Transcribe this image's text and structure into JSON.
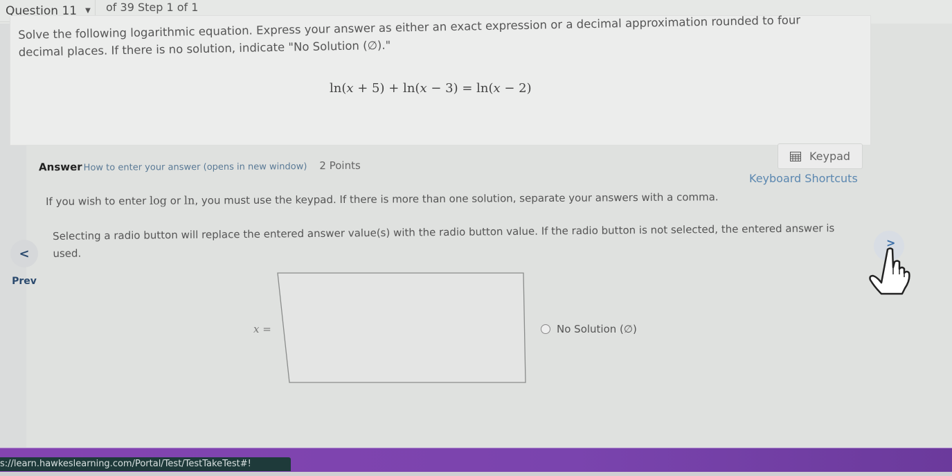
{
  "header": {
    "question_selector": "Question 11",
    "question_progress": "of 39 Step 1 of 1"
  },
  "question": {
    "instruction": "Solve the following logarithmic equation. Express your answer as either an exact expression or a decimal approximation rounded to four decimal places. If there is no solution, indicate \"No Solution (∅).\"",
    "equation": {
      "part1": "ln(",
      "var1": "x",
      "part2": " + 5) + ln(",
      "var2": "x",
      "part3": " − 3)  =  ln(",
      "var3": "x",
      "part4": " − 2)"
    }
  },
  "answer": {
    "label": "Answer",
    "how_to_link": "How to enter your answer (opens in new window)",
    "points": "2 Points",
    "keypad_label": "Keypad",
    "keyboard_shortcuts": "Keyboard Shortcuts",
    "instruction_keypad_pre": "If you wish to enter ",
    "instruction_keypad_log": "log",
    "instruction_keypad_or": " or ",
    "instruction_keypad_ln": "ln",
    "instruction_keypad_post": ", you must use the keypad. If there is more than one solution, separate your answers with a comma.",
    "instruction_radio": "Selecting a radio button will replace the entered answer value(s) with the radio button value. If the radio button is not selected, the entered answer is used.",
    "input_variable": "x",
    "input_equals": " =",
    "input_value": "",
    "no_solution_label": "No Solution (∅)",
    "no_solution_selected": false
  },
  "navigation": {
    "prev_label": "Prev",
    "prev_icon": "<",
    "next_icon": ">"
  },
  "status_bar": {
    "url": "s://learn.hawkeslearning.com/Portal/Test/TestTakeTest#!"
  },
  "colors": {
    "accent_purple": "#7c44b0",
    "link_blue": "#5b87b0",
    "nav_blue": "#2b4a6e"
  }
}
